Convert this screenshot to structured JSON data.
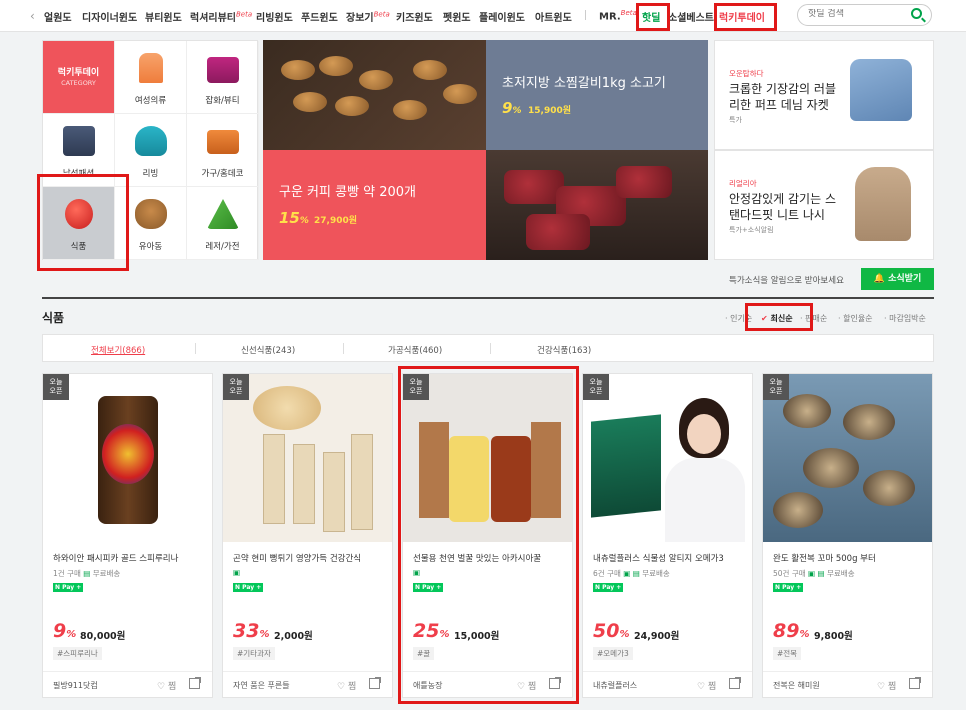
{
  "topnav": {
    "items": [
      "얼원도",
      "디자이너윈도",
      "뷰티윈도",
      "럭셔리뷰티",
      "리빙윈도",
      "푸드윈도",
      "장보기",
      "키즈윈도",
      "펫윈도",
      "플레이윈도",
      "아트윈도"
    ],
    "beta": "Beta",
    "mr": "MR.",
    "hotdeal": "핫딜",
    "social": "소셜베스트",
    "lucky": "럭키투데이",
    "search_placeholder": "핫딜 검색"
  },
  "categories": {
    "head_title": "럭키투데이",
    "head_sub": "CATEGORY",
    "items": [
      "여성의류",
      "잡화/뷰티",
      "남성패션",
      "리빙",
      "가구/홈데코",
      "식품",
      "유아동",
      "레저/가전"
    ]
  },
  "banners": {
    "bread": {
      "title": "구운 커피 콩빵 약 200개",
      "discount": "15",
      "pct": "%",
      "price": "27,900원"
    },
    "beef": {
      "title": "초저지방 소찜갈비1kg 소고기",
      "discount": "9",
      "pct": "%",
      "price": "15,900원"
    },
    "ad1": {
      "brand": "오운탑하다",
      "title": "크롭한 기장감의 러블리한 퍼프 데님 자켓",
      "sub": "특가"
    },
    "ad2": {
      "brand": "리얼리아",
      "title": "안정감있게 감기는 스탠다드핏 니트 나시",
      "sub": "특가+소식알림"
    }
  },
  "alert": {
    "text": "특가소식을 알림으로 받아보세요",
    "button": "소식받기"
  },
  "section": {
    "title": "식품",
    "sorts": [
      "인기순",
      "최신순",
      "판매순",
      "할인율순",
      "마감임박순"
    ],
    "active_sort": "최신순",
    "subtabs": [
      "전체보기(866)",
      "신선식품(243)",
      "가공식품(460)",
      "건강식품(163)"
    ]
  },
  "products": [
    {
      "badge": "오늘\n오픈",
      "name": "하와이안 패시피카 골드 스피루리나",
      "buys": "1건 구매",
      "ship": "무료배송",
      "npay": "N Pay +",
      "discount": "9",
      "price": "80,000원",
      "tag": "#스피루리나",
      "seller": "필방911닷컴",
      "like": "찜"
    },
    {
      "badge": "오늘\n오픈",
      "name": "곤약 현미 뻥튀기 영양가득 건강간식",
      "buys": "",
      "ship": "",
      "npay": "N Pay +",
      "discount": "33",
      "price": "2,000원",
      "tag": "#기타과자",
      "seller": "자연 품은 푸른들",
      "like": "찜"
    },
    {
      "badge": "오늘\n오픈",
      "name": "선물용 천연 벌꿀 맛있는 아카시아꿀",
      "buys": "",
      "ship": "",
      "npay": "N Pay +",
      "discount": "25",
      "price": "15,000원",
      "tag": "#꿀",
      "seller": "애틀농장",
      "like": "찜"
    },
    {
      "badge": "오늘\n오픈",
      "name": "내츄럴플러스 식물성 알티지 오메가3",
      "buys": "6건 구매",
      "ship": "무료배송",
      "npay": "N Pay +",
      "discount": "50",
      "price": "24,900원",
      "tag": "#오메가3",
      "seller": "내츄럴플러스",
      "like": "찜"
    },
    {
      "badge": "오늘\n오픈",
      "name": "완도 활전복 꼬마 500g 부터",
      "buys": "50건 구매",
      "ship": "무료배송",
      "npay": "N Pay +",
      "discount": "89",
      "price": "9,800원",
      "tag": "#전복",
      "seller": "전복은 해미원",
      "like": "찜"
    }
  ],
  "colors": {
    "accent": "#ef3e4a",
    "green": "#00a34a",
    "highlight_box": "#e01818"
  }
}
